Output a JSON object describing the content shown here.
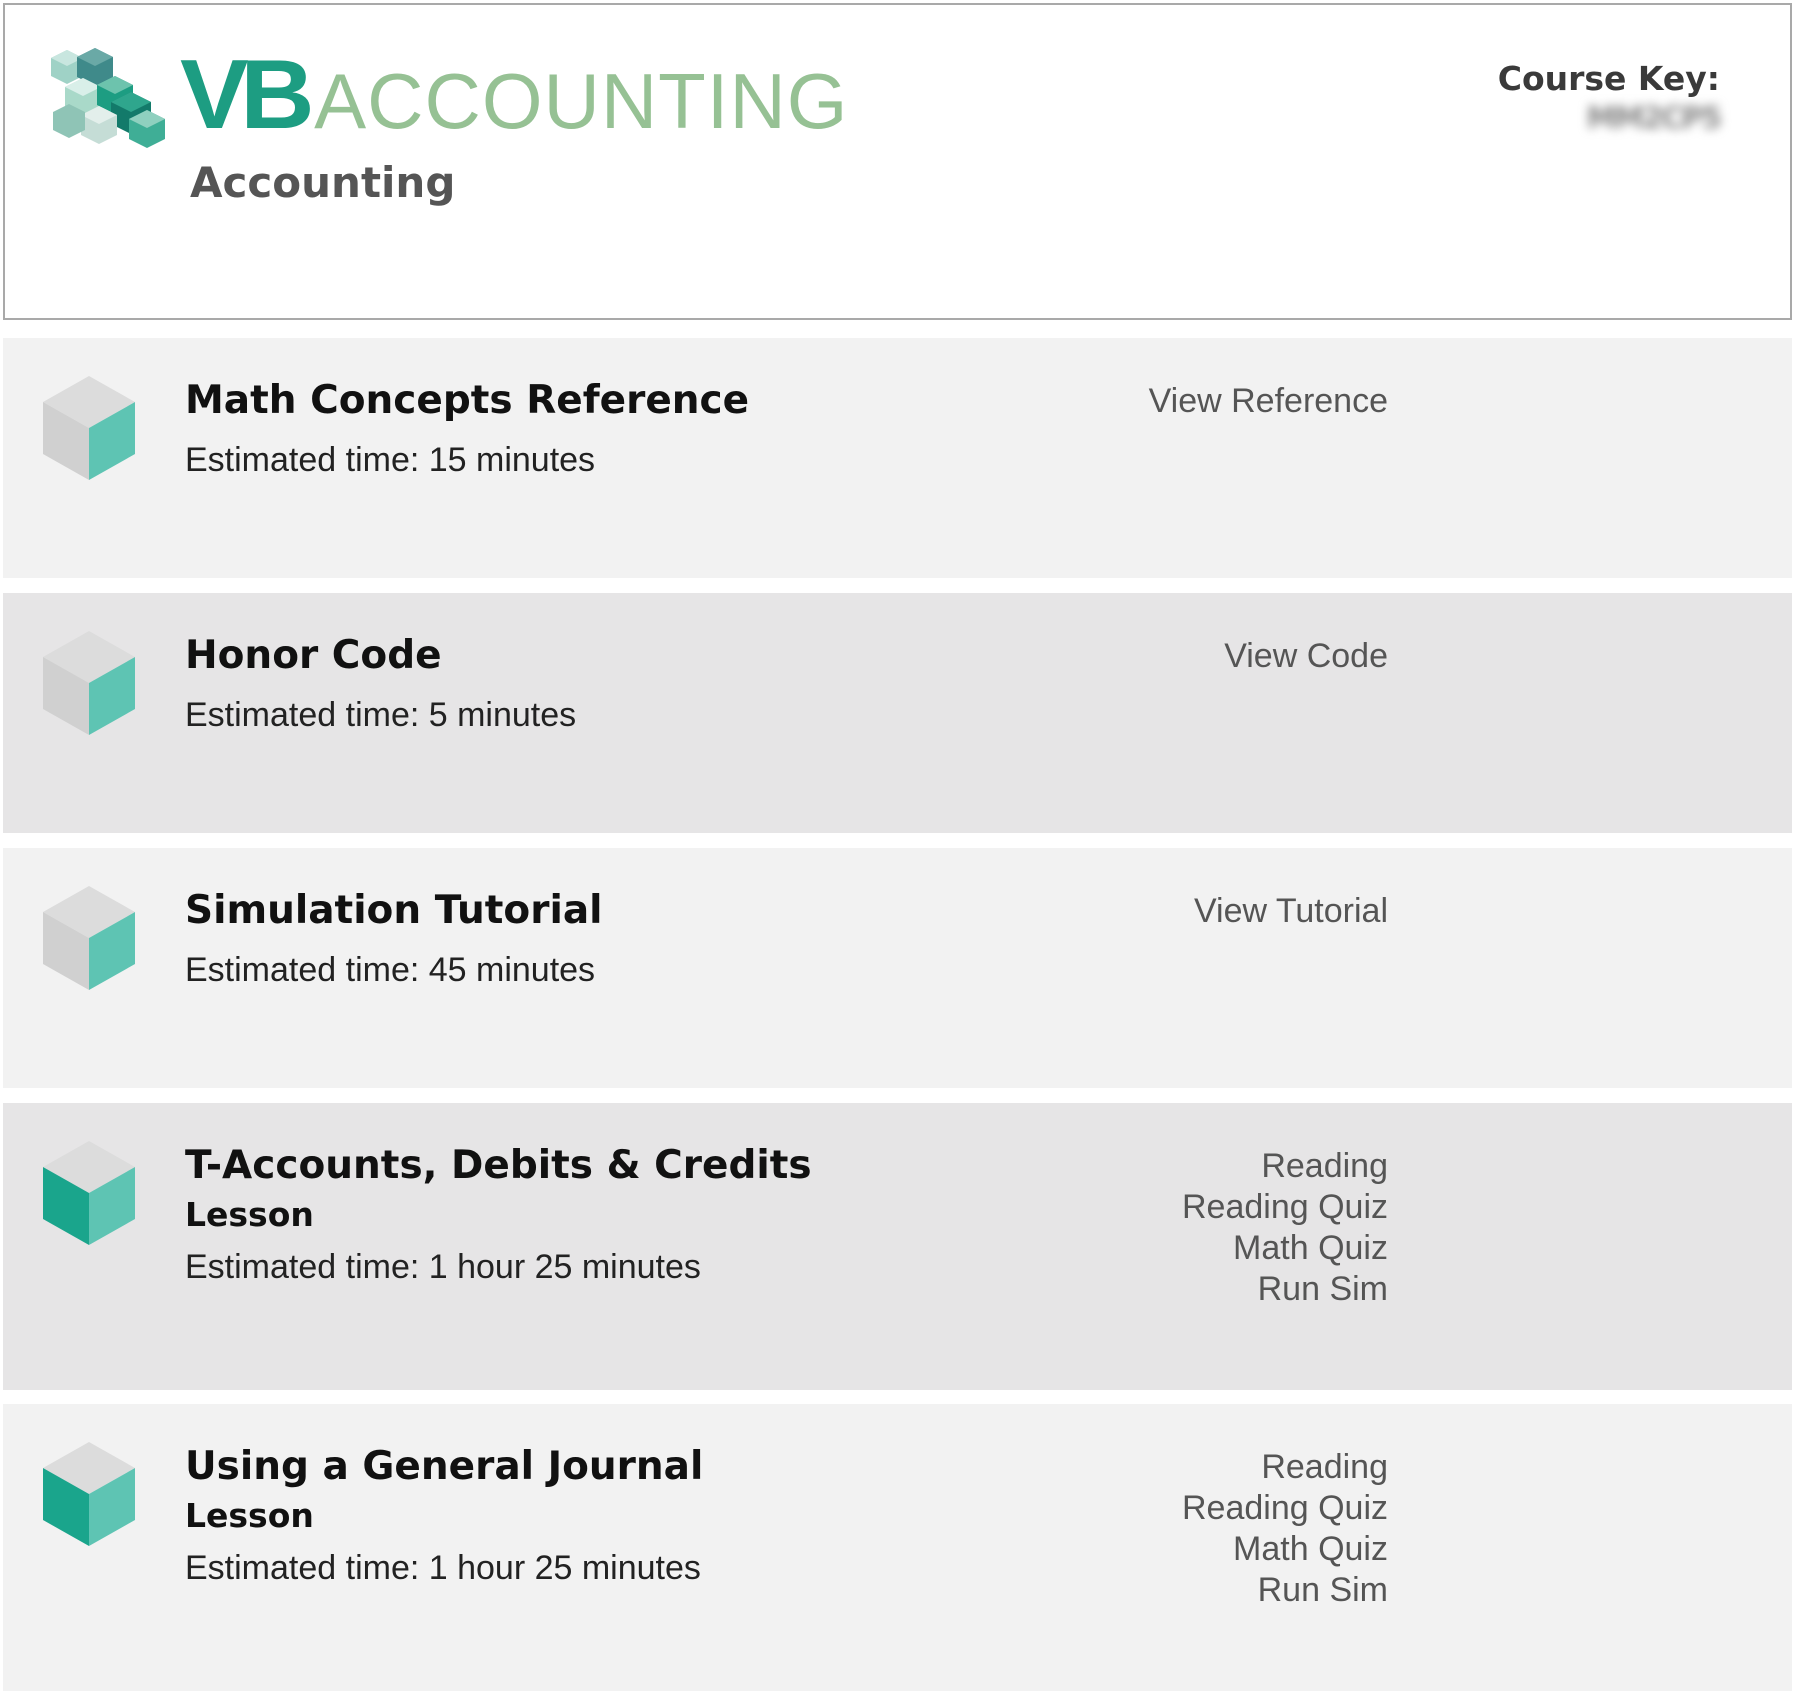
{
  "header": {
    "logo_vb": "VB",
    "logo_accounting": "ACCOUNTING",
    "subtitle": "Accounting",
    "course_key_label": "Course Key:",
    "course_key_value": "MM2CP5"
  },
  "colors": {
    "brand_green": "#1d9d82",
    "brand_light_green": "#96c194",
    "cube_teal": "#5ec4b3",
    "cube_gray": "#d3d3d3",
    "row_light": "#f2f2f2",
    "row_dark": "#e6e5e6"
  },
  "modules": [
    {
      "title": "Math Concepts Reference",
      "type": "",
      "estimated_time": "Estimated time: 15 minutes",
      "icon": "cube-icon-partial",
      "actions": [
        "View Reference"
      ]
    },
    {
      "title": "Honor Code",
      "type": "",
      "estimated_time": "Estimated time: 5 minutes",
      "icon": "cube-icon-partial",
      "actions": [
        "View Code"
      ]
    },
    {
      "title": "Simulation Tutorial",
      "type": "",
      "estimated_time": "Estimated time: 45 minutes",
      "icon": "cube-icon-partial",
      "actions": [
        "View Tutorial"
      ]
    },
    {
      "title": "T-Accounts, Debits & Credits",
      "type": "Lesson",
      "estimated_time": "Estimated time: 1 hour 25 minutes",
      "icon": "cube-icon-full",
      "actions": [
        "Reading",
        "Reading Quiz",
        "Math Quiz",
        "Run Sim"
      ]
    },
    {
      "title": "Using a General Journal",
      "type": "Lesson",
      "estimated_time": "Estimated time: 1 hour 25 minutes",
      "icon": "cube-icon-full",
      "actions": [
        "Reading",
        "Reading Quiz",
        "Math Quiz",
        "Run Sim"
      ]
    }
  ]
}
